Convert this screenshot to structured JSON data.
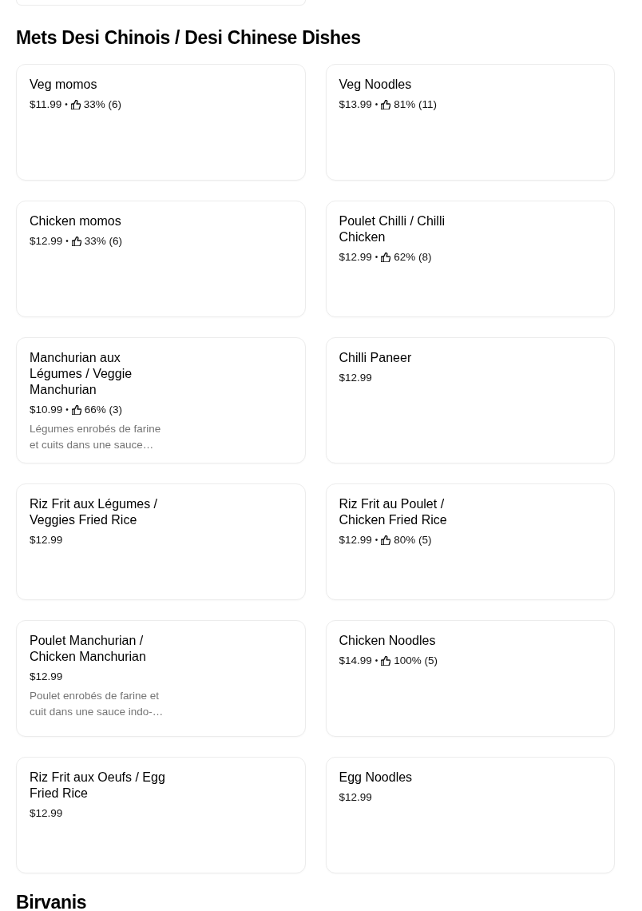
{
  "sections": [
    {
      "title": "Mets Desi Chinois / Desi Chinese Dishes",
      "items": [
        {
          "name": "Veg momos",
          "price": "$11.99",
          "separator": "•",
          "rating": "33% (6)"
        },
        {
          "name": "Veg Noodles",
          "price": "$13.99",
          "separator": "•",
          "rating": "81% (11)"
        },
        {
          "name": "Chicken momos",
          "price": "$12.99",
          "separator": "•",
          "rating": "33% (6)"
        },
        {
          "name": "Poulet Chilli / Chilli Chicken",
          "price": "$12.99",
          "separator": "•",
          "rating": "62% (8)"
        },
        {
          "name": "Manchurian aux Légumes / Veggie Manchurian",
          "price": "$10.99",
          "separator": "•",
          "rating": "66% (3)",
          "description": "Légumes enrobés de farine et cuits dans une sauce…"
        },
        {
          "name": "Chilli Paneer",
          "price": "$12.99"
        },
        {
          "name": "Riz Frit aux Légumes / Veggies Fried Rice",
          "price": "$12.99"
        },
        {
          "name": "Riz Frit au Poulet / Chicken Fried Rice",
          "price": "$12.99",
          "separator": "•",
          "rating": "80% (5)"
        },
        {
          "name": "Poulet Manchurian / Chicken Manchurian",
          "price": "$12.99",
          "description": "Poulet enrobés de farine et cuit dans une sauce indo-…"
        },
        {
          "name": "Chicken Noodles",
          "price": "$14.99",
          "separator": "•",
          "rating": "100% (5)"
        },
        {
          "name": "Riz Frit aux Oeufs / Egg Fried Rice",
          "price": "$12.99"
        },
        {
          "name": "Egg Noodles",
          "price": "$12.99"
        }
      ]
    },
    {
      "title": "Birvanis"
    }
  ]
}
